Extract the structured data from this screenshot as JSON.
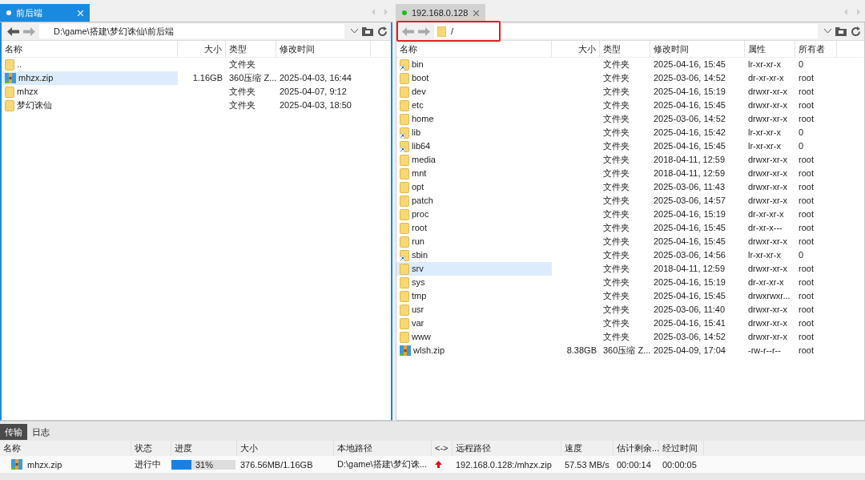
{
  "panes": [
    {
      "tab": {
        "label": "前后端",
        "selected": true,
        "color": "#ffffff"
      },
      "kind": "local",
      "path": "D:\\game\\搭建\\梦幻诛仙\\前后端",
      "columns": [
        "名称",
        "大小",
        "类型",
        "修改时间"
      ],
      "rows": [
        {
          "kind": "folder",
          "name": "..",
          "type": "文件夹",
          "selected": false
        },
        {
          "kind": "zip",
          "name": "mhzx.zip",
          "size": "1.16GB",
          "type": "360压缩 Z...",
          "modified": "2025-04-03, 16:44",
          "selected": true
        },
        {
          "kind": "folder",
          "name": "mhzx",
          "type": "文件夹",
          "modified": "2025-04-07, 9:12",
          "selected": false
        },
        {
          "kind": "folder",
          "name": "梦幻诛仙",
          "type": "文件夹",
          "modified": "2025-04-03, 18:50",
          "selected": false
        }
      ]
    },
    {
      "tab": {
        "label": "192.168.0.128",
        "selected": false,
        "color": "#22bb22"
      },
      "kind": "remote",
      "path": "/",
      "columns": [
        "名称",
        "大小",
        "类型",
        "修改时间",
        "属性",
        "所有者"
      ],
      "rows": [
        {
          "kind": "link",
          "name": "bin",
          "type": "文件夹",
          "modified": "2025-04-16, 15:45",
          "attrs": "lr-xr-xr-x",
          "owner": "0",
          "selected": false
        },
        {
          "kind": "folder",
          "name": "boot",
          "type": "文件夹",
          "modified": "2025-03-06, 14:52",
          "attrs": "dr-xr-xr-x",
          "owner": "root",
          "selected": false
        },
        {
          "kind": "folder",
          "name": "dev",
          "type": "文件夹",
          "modified": "2025-04-16, 15:19",
          "attrs": "drwxr-xr-x",
          "owner": "root",
          "selected": false
        },
        {
          "kind": "folder",
          "name": "etc",
          "type": "文件夹",
          "modified": "2025-04-16, 15:45",
          "attrs": "drwxr-xr-x",
          "owner": "root",
          "selected": false
        },
        {
          "kind": "folder",
          "name": "home",
          "type": "文件夹",
          "modified": "2025-03-06, 14:52",
          "attrs": "drwxr-xr-x",
          "owner": "root",
          "selected": false
        },
        {
          "kind": "link",
          "name": "lib",
          "type": "文件夹",
          "modified": "2025-04-16, 15:42",
          "attrs": "lr-xr-xr-x",
          "owner": "0",
          "selected": false
        },
        {
          "kind": "link",
          "name": "lib64",
          "type": "文件夹",
          "modified": "2025-04-16, 15:45",
          "attrs": "lr-xr-xr-x",
          "owner": "0",
          "selected": false
        },
        {
          "kind": "folder",
          "name": "media",
          "type": "文件夹",
          "modified": "2018-04-11, 12:59",
          "attrs": "drwxr-xr-x",
          "owner": "root",
          "selected": false
        },
        {
          "kind": "folder",
          "name": "mnt",
          "type": "文件夹",
          "modified": "2018-04-11, 12:59",
          "attrs": "drwxr-xr-x",
          "owner": "root",
          "selected": false
        },
        {
          "kind": "folder",
          "name": "opt",
          "type": "文件夹",
          "modified": "2025-03-06, 11:43",
          "attrs": "drwxr-xr-x",
          "owner": "root",
          "selected": false
        },
        {
          "kind": "folder",
          "name": "patch",
          "type": "文件夹",
          "modified": "2025-03-06, 14:57",
          "attrs": "drwxr-xr-x",
          "owner": "root",
          "selected": false
        },
        {
          "kind": "folder",
          "name": "proc",
          "type": "文件夹",
          "modified": "2025-04-16, 15:19",
          "attrs": "dr-xr-xr-x",
          "owner": "root",
          "selected": false
        },
        {
          "kind": "folder",
          "name": "root",
          "type": "文件夹",
          "modified": "2025-04-16, 15:45",
          "attrs": "dr-xr-x---",
          "owner": "root",
          "selected": false
        },
        {
          "kind": "folder",
          "name": "run",
          "type": "文件夹",
          "modified": "2025-04-16, 15:45",
          "attrs": "drwxr-xr-x",
          "owner": "root",
          "selected": false
        },
        {
          "kind": "link",
          "name": "sbin",
          "type": "文件夹",
          "modified": "2025-03-06, 14:56",
          "attrs": "lr-xr-xr-x",
          "owner": "0",
          "selected": false
        },
        {
          "kind": "folder",
          "name": "srv",
          "type": "文件夹",
          "modified": "2018-04-11, 12:59",
          "attrs": "drwxr-xr-x",
          "owner": "root",
          "selected": true
        },
        {
          "kind": "folder",
          "name": "sys",
          "type": "文件夹",
          "modified": "2025-04-16, 15:19",
          "attrs": "dr-xr-xr-x",
          "owner": "root",
          "selected": false
        },
        {
          "kind": "folder",
          "name": "tmp",
          "type": "文件夹",
          "modified": "2025-04-16, 15:45",
          "attrs": "drwxrwxr...",
          "owner": "root",
          "selected": false
        },
        {
          "kind": "folder",
          "name": "usr",
          "type": "文件夹",
          "modified": "2025-03-06, 11:40",
          "attrs": "drwxr-xr-x",
          "owner": "root",
          "selected": false
        },
        {
          "kind": "folder",
          "name": "var",
          "type": "文件夹",
          "modified": "2025-04-16, 15:41",
          "attrs": "drwxr-xr-x",
          "owner": "root",
          "selected": false
        },
        {
          "kind": "folder",
          "name": "www",
          "type": "文件夹",
          "modified": "2025-03-06, 14:52",
          "attrs": "drwxr-xr-x",
          "owner": "root",
          "selected": false
        },
        {
          "kind": "zip",
          "name": "wlsh.zip",
          "size": "8.38GB",
          "type": "360压缩 Z...",
          "modified": "2025-04-09, 17:04",
          "attrs": "-rw-r--r--",
          "owner": "root",
          "selected": false
        }
      ]
    }
  ],
  "bottom_tabs": [
    {
      "label": "传输",
      "selected": true
    },
    {
      "label": "日志",
      "selected": false
    }
  ],
  "transfer": {
    "columns": [
      "名称",
      "状态",
      "进度",
      "大小",
      "本地路径",
      "<->",
      "远程路径",
      "速度",
      "估计剩余...",
      "经过时间"
    ],
    "rows": [
      {
        "kind": "zip",
        "name": "mhzx.zip",
        "status": "进行中",
        "level": 0.31,
        "percent": "31%",
        "size": "376.56MB/1.16GB",
        "local": "D:\\game\\搭建\\梦幻诛...",
        "upload": true,
        "remote": "192.168.0.128:/mhzx.zip",
        "speed": "57.53 MB/s",
        "remaining": "00:00:14",
        "elapsed": "00:00:05"
      }
    ]
  }
}
